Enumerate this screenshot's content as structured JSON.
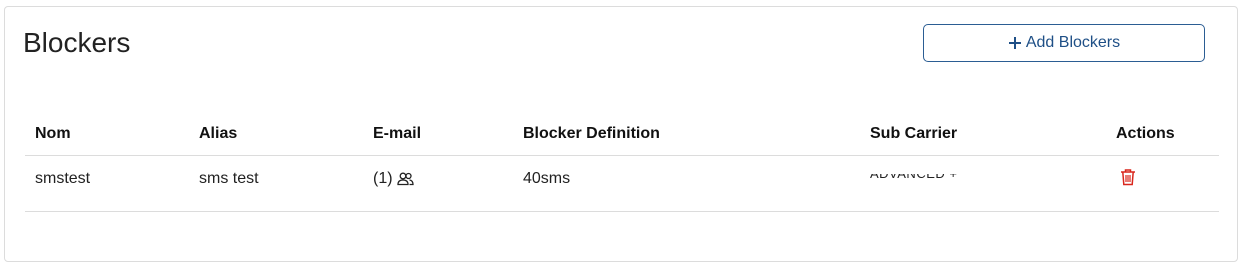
{
  "header": {
    "title": "Blockers",
    "add_button_label": "Add Blockers"
  },
  "table": {
    "columns": [
      "Nom",
      "Alias",
      "E-mail",
      "Blocker Definition",
      "Sub Carrier",
      "Actions"
    ],
    "rows": [
      {
        "nom": "smstest",
        "alias": "sms test",
        "email": "(1)",
        "email_icon": "users-icon",
        "definition": "40sms",
        "sub_carrier": "ADVANCED +",
        "action_icon": "trash-icon"
      }
    ]
  },
  "colors": {
    "accent": "#1e4f86",
    "danger": "#d9261c",
    "border": "#dcdcdc"
  }
}
